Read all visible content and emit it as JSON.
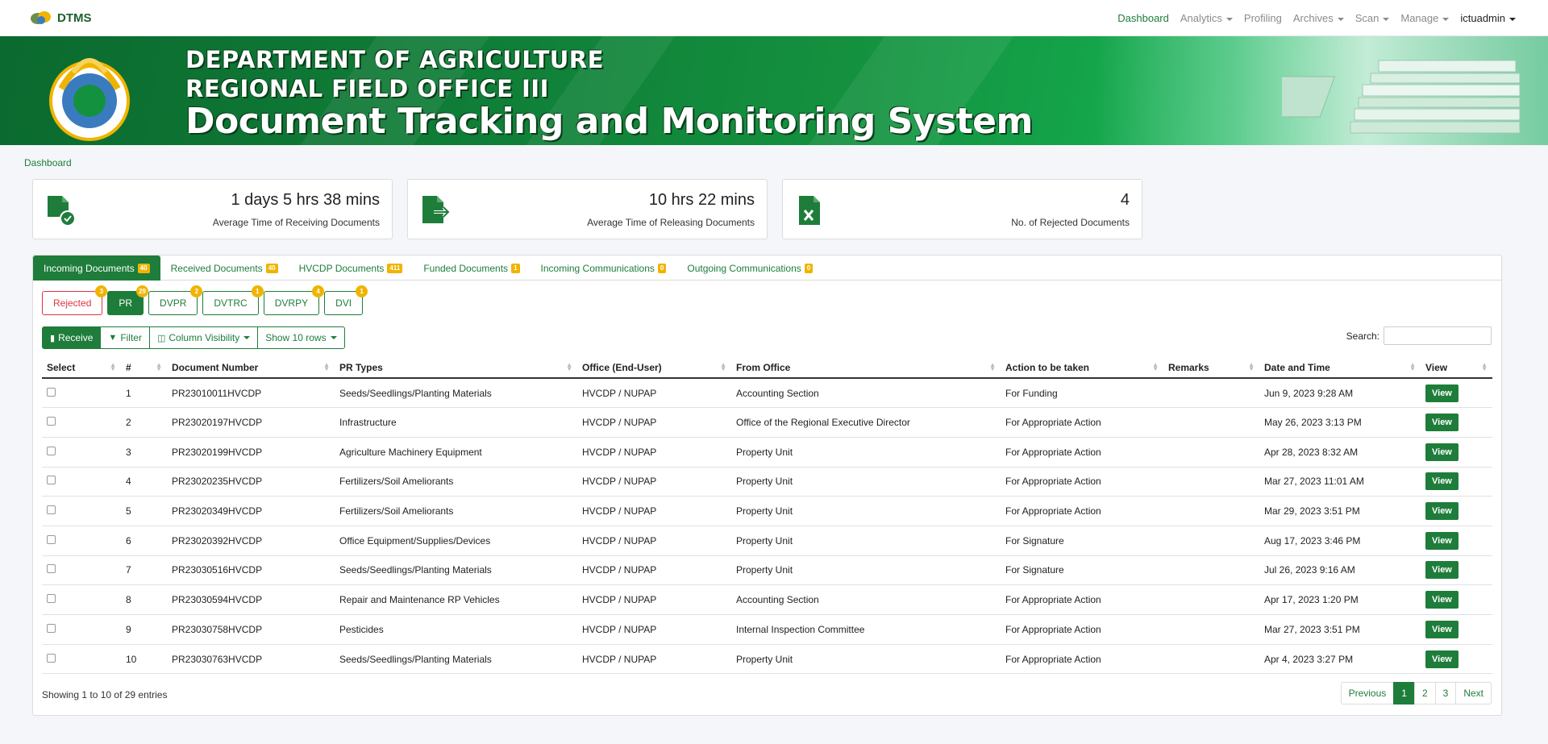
{
  "navbar": {
    "brand": "DTMS",
    "links": [
      {
        "label": "Dashboard",
        "active": true,
        "dropdown": false
      },
      {
        "label": "Analytics",
        "active": false,
        "dropdown": true
      },
      {
        "label": "Profiling",
        "active": false,
        "dropdown": false
      },
      {
        "label": "Archives",
        "active": false,
        "dropdown": true
      },
      {
        "label": "Scan",
        "active": false,
        "dropdown": true
      },
      {
        "label": "Manage",
        "active": false,
        "dropdown": true
      },
      {
        "label": "ictuadmin",
        "active": false,
        "dropdown": true
      }
    ]
  },
  "banner": {
    "line1": "DEPARTMENT OF AGRICULTURE",
    "line2": "REGIONAL FIELD OFFICE III",
    "line3": "Document Tracking and Monitoring System"
  },
  "breadcrumb": "Dashboard",
  "info_boxes": [
    {
      "value": "1 days 5 hrs 38 mins",
      "label": "Average Time of Receiving Documents",
      "icon": "file-check-icon"
    },
    {
      "value": "10 hrs 22 mins",
      "label": "Average Time of Releasing Documents",
      "icon": "file-export-icon"
    },
    {
      "value": "4",
      "label": "No. of Rejected Documents",
      "icon": "file-excel-icon"
    }
  ],
  "tabs": [
    {
      "label": "Incoming Documents",
      "badge": "40",
      "active": true
    },
    {
      "label": "Received Documents",
      "badge": "40",
      "active": false
    },
    {
      "label": "HVCDP Documents",
      "badge": "411",
      "active": false
    },
    {
      "label": "Funded Documents",
      "badge": "1",
      "active": false
    },
    {
      "label": "Incoming Communications",
      "badge": "0",
      "active": false
    },
    {
      "label": "Outgoing Communications",
      "badge": "0",
      "active": false
    }
  ],
  "subtabs": [
    {
      "label": "Rejected",
      "badge": "3",
      "style": "red"
    },
    {
      "label": "PR",
      "badge": "29",
      "style": "active"
    },
    {
      "label": "DVPR",
      "badge": "2",
      "style": "outline"
    },
    {
      "label": "DVTRC",
      "badge": "1",
      "style": "outline"
    },
    {
      "label": "DVRPY",
      "badge": "4",
      "style": "outline"
    },
    {
      "label": "DVI",
      "badge": "1",
      "style": "outline"
    }
  ],
  "toolbar": {
    "receive": "Receive",
    "filter": "Filter",
    "column_visibility": "Column Visibility",
    "show_rows": "Show 10 rows"
  },
  "search": {
    "label": "Search:",
    "value": ""
  },
  "table": {
    "headers": [
      "Select",
      "#",
      "Document Number",
      "PR Types",
      "Office (End-User)",
      "From Office",
      "Action to be taken",
      "Remarks",
      "Date and Time",
      "View"
    ],
    "rows": [
      {
        "num": "1",
        "doc": "PR23010011HVCDP",
        "type": "Seeds/Seedlings/Planting Materials",
        "office": "HVCDP / NUPAP",
        "from": "Accounting Section",
        "action": "For Funding",
        "remarks": "",
        "date": "Jun 9, 2023 9:28 AM"
      },
      {
        "num": "2",
        "doc": "PR23020197HVCDP",
        "type": "Infrastructure",
        "office": "HVCDP / NUPAP",
        "from": "Office of the Regional Executive Director",
        "action": "For Appropriate Action",
        "remarks": "",
        "date": "May 26, 2023 3:13 PM"
      },
      {
        "num": "3",
        "doc": "PR23020199HVCDP",
        "type": "Agriculture Machinery Equipment",
        "office": "HVCDP / NUPAP",
        "from": "Property Unit",
        "action": "For Appropriate Action",
        "remarks": "",
        "date": "Apr 28, 2023 8:32 AM"
      },
      {
        "num": "4",
        "doc": "PR23020235HVCDP",
        "type": "Fertilizers/Soil Ameliorants",
        "office": "HVCDP / NUPAP",
        "from": "Property Unit",
        "action": "For Appropriate Action",
        "remarks": "",
        "date": "Mar 27, 2023 11:01 AM"
      },
      {
        "num": "5",
        "doc": "PR23020349HVCDP",
        "type": "Fertilizers/Soil Ameliorants",
        "office": "HVCDP / NUPAP",
        "from": "Property Unit",
        "action": "For Appropriate Action",
        "remarks": "",
        "date": "Mar 29, 2023 3:51 PM"
      },
      {
        "num": "6",
        "doc": "PR23020392HVCDP",
        "type": "Office Equipment/Supplies/Devices",
        "office": "HVCDP / NUPAP",
        "from": "Property Unit",
        "action": "For Signature",
        "remarks": "",
        "date": "Aug 17, 2023 3:46 PM"
      },
      {
        "num": "7",
        "doc": "PR23030516HVCDP",
        "type": "Seeds/Seedlings/Planting Materials",
        "office": "HVCDP / NUPAP",
        "from": "Property Unit",
        "action": "For Signature",
        "remarks": "",
        "date": "Jul 26, 2023 9:16 AM"
      },
      {
        "num": "8",
        "doc": "PR23030594HVCDP",
        "type": "Repair and Maintenance RP Vehicles",
        "office": "HVCDP / NUPAP",
        "from": "Accounting Section",
        "action": "For Appropriate Action",
        "remarks": "",
        "date": "Apr 17, 2023 1:20 PM"
      },
      {
        "num": "9",
        "doc": "PR23030758HVCDP",
        "type": "Pesticides",
        "office": "HVCDP / NUPAP",
        "from": "Internal Inspection Committee",
        "action": "For Appropriate Action",
        "remarks": "",
        "date": "Mar 27, 2023 3:51 PM"
      },
      {
        "num": "10",
        "doc": "PR23030763HVCDP",
        "type": "Seeds/Seedlings/Planting Materials",
        "office": "HVCDP / NUPAP",
        "from": "Property Unit",
        "action": "For Appropriate Action",
        "remarks": "",
        "date": "Apr 4, 2023 3:27 PM"
      }
    ],
    "view_label": "View"
  },
  "footer": {
    "showing": "Showing 1 to 10 of 29 entries",
    "pages": [
      "Previous",
      "1",
      "2",
      "3",
      "Next"
    ],
    "active_page": "1"
  },
  "colors": {
    "primary": "#1e7d3a",
    "badge": "#f0b400",
    "danger": "#dc3545"
  }
}
